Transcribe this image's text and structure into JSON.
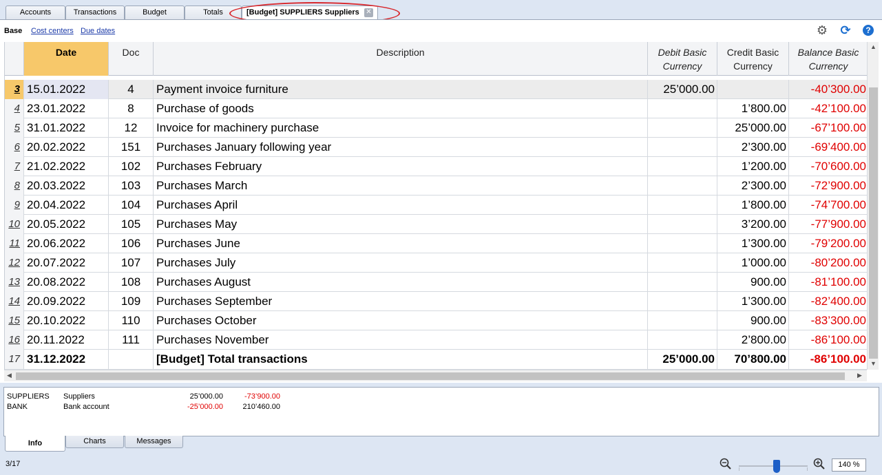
{
  "tabs": [
    {
      "label": "Accounts"
    },
    {
      "label": "Transactions"
    },
    {
      "label": "Budget"
    },
    {
      "label": "Totals"
    },
    {
      "label": "[Budget] SUPPLIERS Suppliers"
    }
  ],
  "tab_close_glyph": "✕",
  "views": {
    "base": "Base",
    "cost_centers": "Cost centers",
    "due_dates": "Due dates"
  },
  "toolbar_icons": {
    "settings": "⚙",
    "refresh": "⟳",
    "help": "?"
  },
  "columns": {
    "date": "Date",
    "doc": "Doc",
    "description": "Description",
    "debit": "Debit Basic Currency",
    "credit": "Credit Basic Currency",
    "balance": "Balance Basic Currency"
  },
  "rows": [
    {
      "n": "3",
      "date": "15.01.2022",
      "doc": "4",
      "desc": "Payment invoice furniture",
      "debit": "25’000.00",
      "credit": "",
      "balance": "-40’300.00"
    },
    {
      "n": "4",
      "date": "23.01.2022",
      "doc": "8",
      "desc": "Purchase of goods",
      "debit": "",
      "credit": "1’800.00",
      "balance": "-42’100.00"
    },
    {
      "n": "5",
      "date": "31.01.2022",
      "doc": "12",
      "desc": "Invoice for machinery purchase",
      "debit": "",
      "credit": "25’000.00",
      "balance": "-67’100.00"
    },
    {
      "n": "6",
      "date": "20.02.2022",
      "doc": "151",
      "desc": "Purchases January following year",
      "debit": "",
      "credit": "2’300.00",
      "balance": "-69’400.00"
    },
    {
      "n": "7",
      "date": "21.02.2022",
      "doc": "102",
      "desc": "Purchases February",
      "debit": "",
      "credit": "1’200.00",
      "balance": "-70’600.00"
    },
    {
      "n": "8",
      "date": "20.03.2022",
      "doc": "103",
      "desc": "Purchases March",
      "debit": "",
      "credit": "2’300.00",
      "balance": "-72’900.00"
    },
    {
      "n": "9",
      "date": "20.04.2022",
      "doc": "104",
      "desc": "Purchases April",
      "debit": "",
      "credit": "1’800.00",
      "balance": "-74’700.00"
    },
    {
      "n": "10",
      "date": "20.05.2022",
      "doc": "105",
      "desc": "Purchases May",
      "debit": "",
      "credit": "3’200.00",
      "balance": "-77’900.00"
    },
    {
      "n": "11",
      "date": "20.06.2022",
      "doc": "106",
      "desc": "Purchases June",
      "debit": "",
      "credit": "1’300.00",
      "balance": "-79’200.00"
    },
    {
      "n": "12",
      "date": "20.07.2022",
      "doc": "107",
      "desc": "Purchases July",
      "debit": "",
      "credit": "1’000.00",
      "balance": "-80’200.00"
    },
    {
      "n": "13",
      "date": "20.08.2022",
      "doc": "108",
      "desc": "Purchases August",
      "debit": "",
      "credit": "900.00",
      "balance": "-81’100.00"
    },
    {
      "n": "14",
      "date": "20.09.2022",
      "doc": "109",
      "desc": "Purchases September",
      "debit": "",
      "credit": "1’300.00",
      "balance": "-82’400.00"
    },
    {
      "n": "15",
      "date": "20.10.2022",
      "doc": "110",
      "desc": "Purchases October",
      "debit": "",
      "credit": "900.00",
      "balance": "-83’300.00"
    },
    {
      "n": "16",
      "date": "20.11.2022",
      "doc": "111",
      "desc": "Purchases November",
      "debit": "",
      "credit": "2’800.00",
      "balance": "-86’100.00"
    }
  ],
  "total_row": {
    "n": "17",
    "date": "31.12.2022",
    "doc": "",
    "desc": "[Budget] Total transactions",
    "debit": "25’000.00",
    "credit": "70’800.00",
    "balance": "-86’100.00"
  },
  "info": [
    {
      "code": "SUPPLIERS",
      "name": "Suppliers",
      "amount": "25’000.00",
      "balance": "-73’900.00"
    },
    {
      "code": "BANK",
      "name": "Bank account",
      "amount": "-25’000.00",
      "balance": "210’460.00"
    }
  ],
  "bottom_tabs": [
    {
      "label": "Info"
    },
    {
      "label": "Charts"
    },
    {
      "label": "Messages"
    }
  ],
  "status": {
    "position": "3/17",
    "zoom": "140 %",
    "zoom_out": "−",
    "zoom_in": "+"
  },
  "colors": {
    "negative": "#e00000",
    "selected_header": "#f7c86a",
    "highlight_ring": "#d8262b"
  }
}
